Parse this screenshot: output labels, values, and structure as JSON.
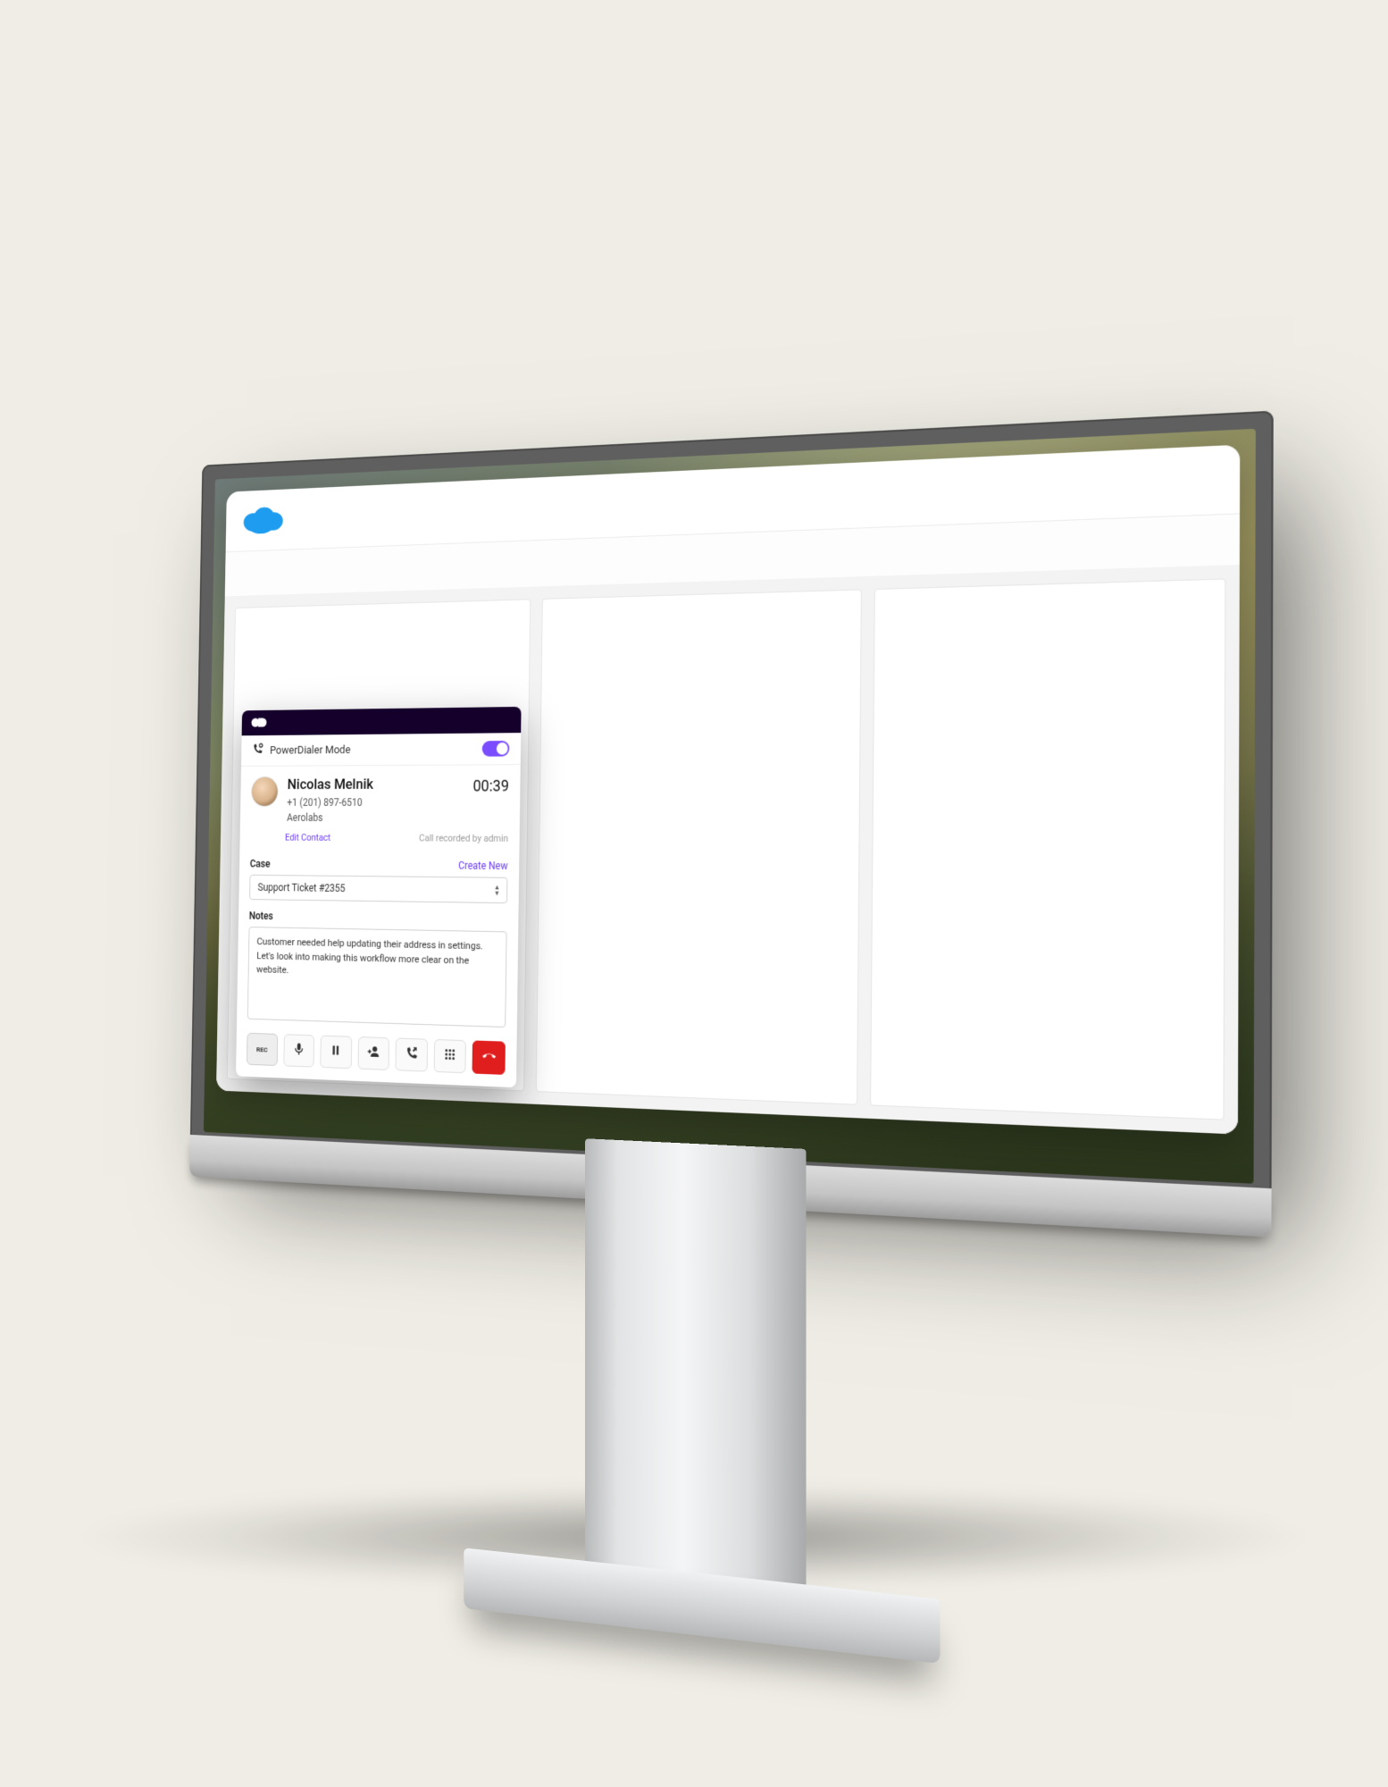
{
  "dialer": {
    "mode_label": "PowerDialer Mode",
    "toggle_on": true,
    "contact": {
      "name": "Nicolas Melnik",
      "phone": "+1 (201) 897-6510",
      "company": "Aerolabs",
      "edit_link": "Edit Contact"
    },
    "call_timer": "00:39",
    "recording_notice": "Call recorded by admin",
    "case": {
      "label": "Case",
      "create_link": "Create New",
      "selected": "Support Ticket #2355"
    },
    "notes": {
      "label": "Notes",
      "text": "Customer needed help updating their address in settings. Let's look into making this workflow more clear on the website."
    },
    "controls": {
      "rec_label": "REC"
    }
  }
}
